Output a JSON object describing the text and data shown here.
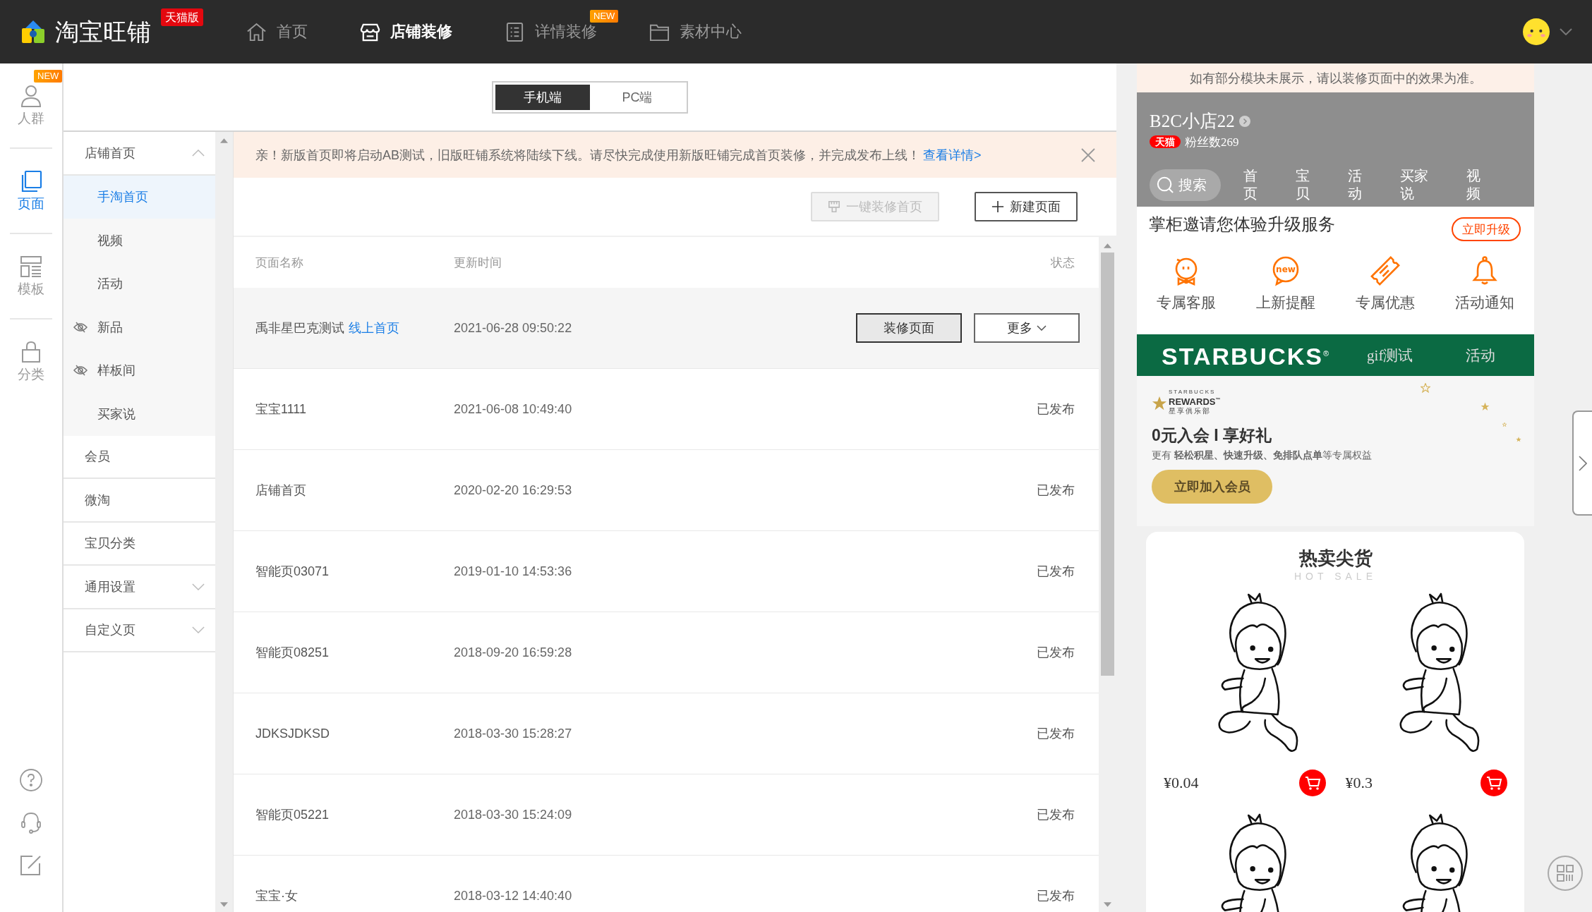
{
  "header": {
    "logo": "淘宝旺铺",
    "edition_badge": "天猫版",
    "nav": [
      {
        "label": "首页",
        "selected": false
      },
      {
        "label": "店铺装修",
        "selected": true
      },
      {
        "label": "详情装修",
        "selected": false,
        "badge": "NEW"
      },
      {
        "label": "素材中心",
        "selected": false
      }
    ]
  },
  "side_rail": {
    "items": [
      {
        "label": "人群",
        "selected": false,
        "badge": "NEW"
      },
      {
        "label": "页面",
        "selected": true
      },
      {
        "label": "模板",
        "selected": false
      },
      {
        "label": "分类",
        "selected": false
      }
    ]
  },
  "device_tabs": [
    {
      "label": "手机端",
      "selected": true
    },
    {
      "label": "PC端",
      "selected": false
    }
  ],
  "page_tree": [
    {
      "label": "店铺首页",
      "kind": "group",
      "expanded": true,
      "selected": false,
      "children": [
        {
          "label": "手淘首页",
          "selected": true,
          "hidden": false
        },
        {
          "label": "视频",
          "selected": false,
          "hidden": false
        },
        {
          "label": "活动",
          "selected": false,
          "hidden": false
        },
        {
          "label": "新品",
          "selected": false,
          "hidden": true
        },
        {
          "label": "样板间",
          "selected": false,
          "hidden": true
        },
        {
          "label": "买家说",
          "selected": false,
          "hidden": false
        }
      ]
    },
    {
      "label": "会员",
      "kind": "page",
      "selected": false
    },
    {
      "label": "微淘",
      "kind": "page",
      "selected": false
    },
    {
      "label": "宝贝分类",
      "kind": "page",
      "selected": false
    },
    {
      "label": "通用设置",
      "kind": "group",
      "expanded": false,
      "selected": false
    },
    {
      "label": "自定义页",
      "kind": "group",
      "expanded": false,
      "selected": false
    }
  ],
  "notice": {
    "text": "亲！新版首页即将启动AB测试，旧版旺铺系统将陆续下线。请尽快完成使用新版旺铺完成首页装修，并完成发布上线！",
    "link": "查看详情>"
  },
  "toolbar": [
    {
      "label": "一键装修首页",
      "disabled": true
    },
    {
      "label": "新建页面",
      "disabled": false
    }
  ],
  "table": {
    "columns": [
      "页面名称",
      "更新时间",
      "状态"
    ],
    "rows": [
      {
        "name": "禹非星巴克测试",
        "tag": "线上首页",
        "updated": "2021-06-28 09:50:22",
        "hovered": true,
        "actions": [
          "装修页面",
          "更多"
        ]
      },
      {
        "name": "宝宝1111",
        "updated": "2021-06-08 10:49:40",
        "status": "已发布",
        "hovered": false
      },
      {
        "name": "店铺首页",
        "updated": "2020-02-20 16:29:53",
        "status": "已发布",
        "hovered": false
      },
      {
        "name": "智能页03071",
        "updated": "2019-01-10 14:53:36",
        "status": "已发布",
        "hovered": false
      },
      {
        "name": "智能页08251",
        "updated": "2018-09-20 16:59:28",
        "status": "已发布",
        "hovered": false
      },
      {
        "name": "JDKSJDKSD",
        "updated": "2018-03-30 15:28:27",
        "status": "已发布",
        "hovered": false
      },
      {
        "name": "智能页05221",
        "updated": "2018-03-30 15:24:09",
        "status": "已发布",
        "hovered": false
      },
      {
        "name": "宝宝·女",
        "updated": "2018-03-12 14:40:40",
        "status": "已发布",
        "hovered": false
      }
    ]
  },
  "preview": {
    "notice": "如有部分模块未展示，请以装修页面中的效果为准。",
    "shop": {
      "name": "B2C小店22",
      "badge": "天猫",
      "fans": "粉丝数269"
    },
    "search_label": "搜索",
    "nav": [
      "首页",
      "宝贝",
      "活动",
      "买家说",
      "视频"
    ],
    "upgrade": {
      "text": "掌柜邀请您体验升级服务",
      "button": "立即升级"
    },
    "services": [
      {
        "label": "专属客服"
      },
      {
        "label": "上新提醒",
        "icon_text": "new"
      },
      {
        "label": "专属优惠"
      },
      {
        "label": "活动通知"
      }
    ],
    "brand_bar": {
      "logo": "STARBUCKS$^{®}$",
      "links": [
        "gif测试",
        "活动"
      ]
    },
    "rewards": {
      "logo_top": "STARBUCKS",
      "logo_main": "REWARDS$^{™}$",
      "logo_sub": "星享俱乐部",
      "title": "0元入会 I 享好礼",
      "subtitle": "更有 **轻松积星、快速升级、免排队点单**等专属权益",
      "button": "立即加入会员"
    },
    "hot_sale": {
      "title": "热卖尖货",
      "subtitle": "HOT SALE",
      "products": [
        {
          "kind": "product",
          "price": "¥0.04"
        },
        {
          "kind": "product",
          "price": "¥0.3"
        },
        {
          "kind": "product"
        },
        {
          "kind": "product"
        }
      ]
    }
  }
}
